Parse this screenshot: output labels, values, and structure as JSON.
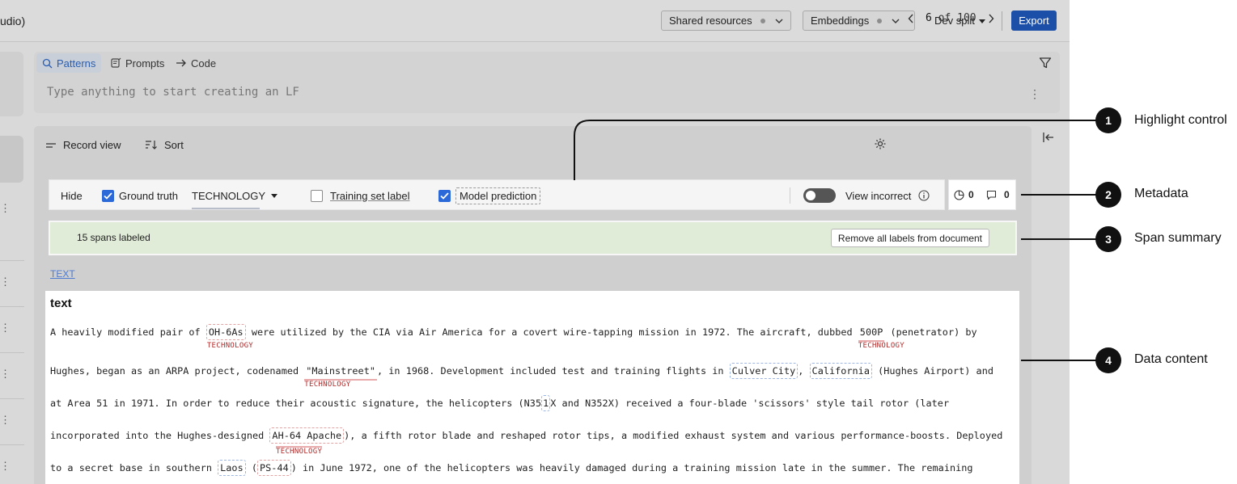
{
  "topbar": {
    "app_title": "udio)",
    "shared_resources": "Shared resources",
    "embeddings": "Embeddings",
    "dev_split": "Dev split",
    "export": "Export"
  },
  "lf_panel": {
    "tabs": [
      {
        "label": "Patterns",
        "icon": "search-icon",
        "active": true
      },
      {
        "label": "Prompts",
        "icon": "prompt-icon",
        "active": false
      },
      {
        "label": "Code",
        "icon": "arrow-right-icon",
        "active": false
      }
    ],
    "placeholder": "Type anything to start creating an LF"
  },
  "record_view": {
    "record_view_label": "Record view",
    "sort_label": "Sort",
    "pager": {
      "current": "6",
      "of_text": "of 100"
    }
  },
  "controls": {
    "hide": "Hide",
    "ground_truth": "Ground truth",
    "ground_truth_checked": true,
    "selected_class": "TECHNOLOGY",
    "training_set_label": "Training set label",
    "training_set_checked": false,
    "model_prediction": "Model prediction",
    "model_prediction_checked": true,
    "view_incorrect": "View incorrect",
    "view_incorrect_on": false
  },
  "metadata": {
    "history_count": "0",
    "comment_count": "0"
  },
  "span_summary": {
    "count_text": "15 spans labeled",
    "remove_button": "Remove all labels from document"
  },
  "field_link": "TEXT",
  "document": {
    "field_title": "text",
    "tag_label": "TECHNOLOGY",
    "line1": {
      "pre": "A heavily modified pair of ",
      "span1": "OH-6As",
      "mid": " were utilized by the CIA via Air America for a covert wire-tapping mission in 1972. The aircraft, dubbed ",
      "span2": "500P",
      "post": " (penetrator) by"
    },
    "line2": {
      "pre": "Hughes, began as an ARPA project, codenamed ",
      "span1": "\"Mainstreet\"",
      "mid": ", in 1968.  Development included test and training flights in ",
      "span2": "Culver City",
      "sep": ", ",
      "span3": "California",
      "post": " (Hughes Airport) and"
    },
    "line3": {
      "pre": "at Area 51 in 1971. In order to reduce their acoustic signature, the helicopters (N35",
      "span1": "1",
      "post": "X and N352X) received a four-blade 'scissors' style tail rotor (later"
    },
    "line4": {
      "pre": "incorporated into the Hughes-designed ",
      "span1": "AH-64 Apache",
      "post": "), a fifth rotor blade and reshaped rotor tips, a modified exhaust system and various performance-boosts.  Deployed"
    },
    "line5": {
      "pre": "to a secret base in southern ",
      "span1": "Laos",
      "mid": " (",
      "span2": "PS-44",
      "post": ") in June 1972, one of the helicopters was heavily damaged during a training mission late in the summer.  The remaining"
    }
  },
  "callouts": [
    {
      "number": "1",
      "label": "Highlight control"
    },
    {
      "number": "2",
      "label": "Metadata"
    },
    {
      "number": "3",
      "label": "Span summary"
    },
    {
      "number": "4",
      "label": "Data content"
    }
  ],
  "colors": {
    "accent_blue": "#2b68d8",
    "export_blue": "#1c4fa8",
    "span_summary_green": "#e0ecd7",
    "tag_red": "#b22b2b"
  }
}
